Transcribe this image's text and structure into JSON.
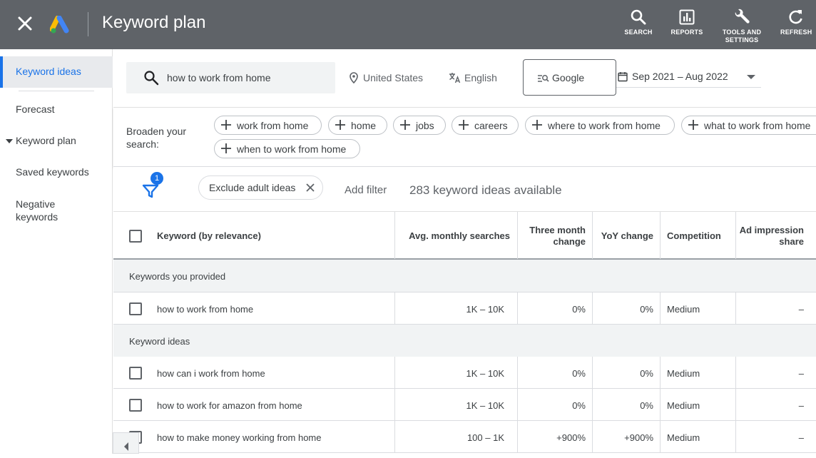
{
  "topbar": {
    "title": "Keyword plan",
    "tools": [
      {
        "label": "SEARCH"
      },
      {
        "label": "REPORTS"
      },
      {
        "label_line1": "TOOLS AND",
        "label_line2": "SETTINGS"
      },
      {
        "label": "REFRESH"
      }
    ]
  },
  "sidebar": {
    "items": [
      {
        "label": "Keyword ideas"
      },
      {
        "label": "Forecast"
      },
      {
        "label": "Keyword plan"
      },
      {
        "label": "Saved keywords"
      },
      {
        "label_line1": "Negative",
        "label_line2": "keywords"
      }
    ]
  },
  "search": {
    "query": "how to work from home",
    "location": "United States",
    "language": "English",
    "network": "Google",
    "date_range": "Sep 2021 – Aug 2022"
  },
  "broaden": {
    "label_line1": "Broaden your",
    "label_line2": "search:",
    "chips": [
      "work from home",
      "home",
      "jobs",
      "careers",
      "where to work from home",
      "what to work from home",
      "when to work from home"
    ]
  },
  "filters": {
    "badge_count": "1",
    "exclude_label": "Exclude adult ideas",
    "add_filter": "Add filter",
    "summary": "283 keyword ideas available"
  },
  "table": {
    "headers": {
      "keyword": "Keyword (by relevance)",
      "avg": "Avg. monthly searches",
      "three_month_line1": "Three month",
      "three_month_line2": "change",
      "yoy": "YoY change",
      "competition": "Competition",
      "ad_share_line1": "Ad impression",
      "ad_share_line2": "share"
    },
    "group_provided": "Keywords you provided",
    "group_ideas": "Keyword ideas",
    "provided_rows": [
      {
        "keyword": "how to work from home",
        "avg": "1K – 10K",
        "three_month": "0%",
        "yoy": "0%",
        "competition": "Medium",
        "ad_share": "–"
      }
    ],
    "idea_rows": [
      {
        "keyword": "how can i work from home",
        "avg": "1K – 10K",
        "three_month": "0%",
        "yoy": "0%",
        "competition": "Medium",
        "ad_share": "–"
      },
      {
        "keyword": "how to work for amazon from home",
        "avg": "1K – 10K",
        "three_month": "0%",
        "yoy": "0%",
        "competition": "Medium",
        "ad_share": "–"
      },
      {
        "keyword": "how to make money working from home",
        "avg": "100 – 1K",
        "three_month": "+900%",
        "yoy": "+900%",
        "competition": "Medium",
        "ad_share": "–"
      }
    ]
  },
  "colors": {
    "topbar": "#5f6368",
    "accent": "#1a73e8"
  }
}
